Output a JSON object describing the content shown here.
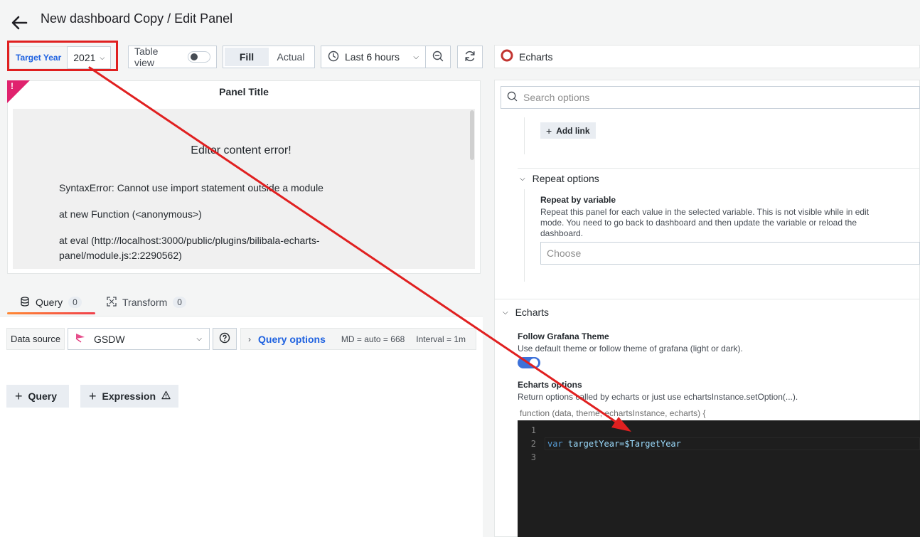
{
  "header": {
    "title": "New dashboard Copy / Edit Panel"
  },
  "toolbar": {
    "variable": {
      "label": "Target Year",
      "value": "2021"
    },
    "table_view_label": "Table view",
    "fill_label": "Fill",
    "actual_label": "Actual",
    "time_range": "Last 6 hours"
  },
  "panel": {
    "title": "Panel Title",
    "error_title": "Editor content error!",
    "error_lines": [
      "SyntaxError: Cannot use import statement outside a module",
      "at new Function (<anonymous>)",
      "at eval (http://localhost:3000/public/plugins/bilibala-echarts-",
      "panel/module.js:2:2290562)"
    ]
  },
  "query_tabs": {
    "query_label": "Query",
    "query_count": "0",
    "transform_label": "Transform",
    "transform_count": "0"
  },
  "query_editor": {
    "datasource_label": "Data source",
    "datasource_value": "GSDW",
    "query_options_label": "Query options",
    "md_text": "MD = auto = 668",
    "interval_text": "Interval = 1m",
    "add_query_label": "Query",
    "add_expression_label": "Expression"
  },
  "options": {
    "visualization": "Echarts",
    "search_placeholder": "Search options",
    "add_link_label": "Add link",
    "repeat_section": "Repeat options",
    "repeat_by_label": "Repeat by variable",
    "repeat_by_desc_lines": [
      "Repeat this panel for each value in the selected variable. This is not visible while in edit",
      "mode. You need to go back to dashboard and then update the variable or reload the",
      "dashboard."
    ],
    "choose_placeholder": "Choose",
    "echarts_section": "Echarts",
    "follow_theme_label": "Follow Grafana Theme",
    "follow_theme_desc": "Use default theme or follow theme of grafana (light or dark).",
    "echarts_options_label": "Echarts options",
    "echarts_options_desc": "Return options called by echarts or just use echartsInstance.setOption(...).",
    "function_signature": "function (data, theme, echartsInstance, echarts) {"
  },
  "code": {
    "line_numbers": [
      "1",
      "2",
      "3"
    ],
    "line2_keyword": "var",
    "line2_rest": "targetYear=$TargetYear"
  },
  "colors": {
    "accent": "#1f62e0",
    "annotation": "#e02020",
    "error_corner": "#e0226e",
    "toggle_on": "#3d71d9"
  }
}
